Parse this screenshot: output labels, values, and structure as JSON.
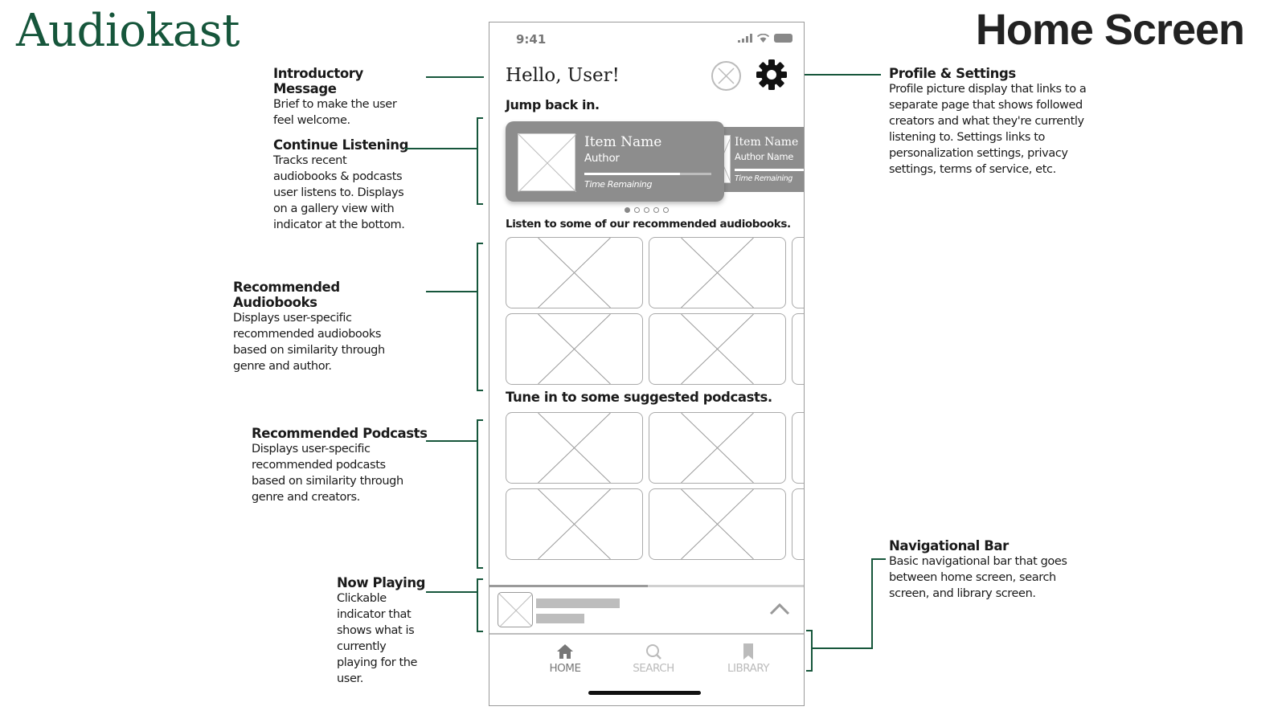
{
  "brand": "Audiokast",
  "page_title": "Home Screen",
  "annotations": {
    "intro": {
      "title": "Introductory Message",
      "desc": [
        "Brief to make the user",
        "feel welcome."
      ]
    },
    "continue": {
      "title": "Continue Listening",
      "desc": [
        "Tracks recent",
        "audiobooks & podcasts",
        "user listens to. Displays",
        "on a gallery view with",
        "indicator at the bottom."
      ]
    },
    "rec_audio": {
      "title": "Recommended Audiobooks",
      "desc": [
        "Displays user-specific",
        "recommended audiobooks",
        "based on similarity through",
        "genre and author."
      ]
    },
    "rec_pod": {
      "title": "Recommended Podcasts",
      "desc": [
        "Displays user-specific",
        "recommended podcasts",
        "based on similarity through",
        "genre and creators."
      ]
    },
    "now_playing": {
      "title": "Now Playing",
      "desc": [
        "Clickable",
        "indicator that",
        "shows what is",
        "currently",
        "playing for the",
        "user."
      ]
    },
    "profile": {
      "title": "Profile & Settings",
      "desc": [
        "Profile picture display that links to a",
        "separate page that shows followed",
        "creators and what they're currently",
        "listening to. Settings links to",
        "personalization settings, privacy",
        "settings, terms of service, etc."
      ]
    },
    "navbar": {
      "title": "Navigational Bar",
      "desc": [
        "Basic navigational bar that goes",
        "between home screen, search",
        "screen, and library screen."
      ]
    }
  },
  "phone": {
    "status_time": "9:41",
    "greeting": "Hello, User!",
    "jump_back": "Jump back in.",
    "card1": {
      "name": "Item Name",
      "author": "Author",
      "time": "Time Remaining",
      "progress": 0.75
    },
    "card2": {
      "name": "Item Name",
      "author": "Author Name",
      "time": "Time Remaining"
    },
    "carousel": {
      "pages": 5,
      "active": 0
    },
    "rec_audio_title": "Listen to some of our recommended audiobooks.",
    "rec_pod_title": "Tune in to some suggested podcasts.",
    "now_playing_progress": 0.5,
    "nav": {
      "home": "HOME",
      "search": "SEARCH",
      "library": "LIBRARY"
    }
  }
}
